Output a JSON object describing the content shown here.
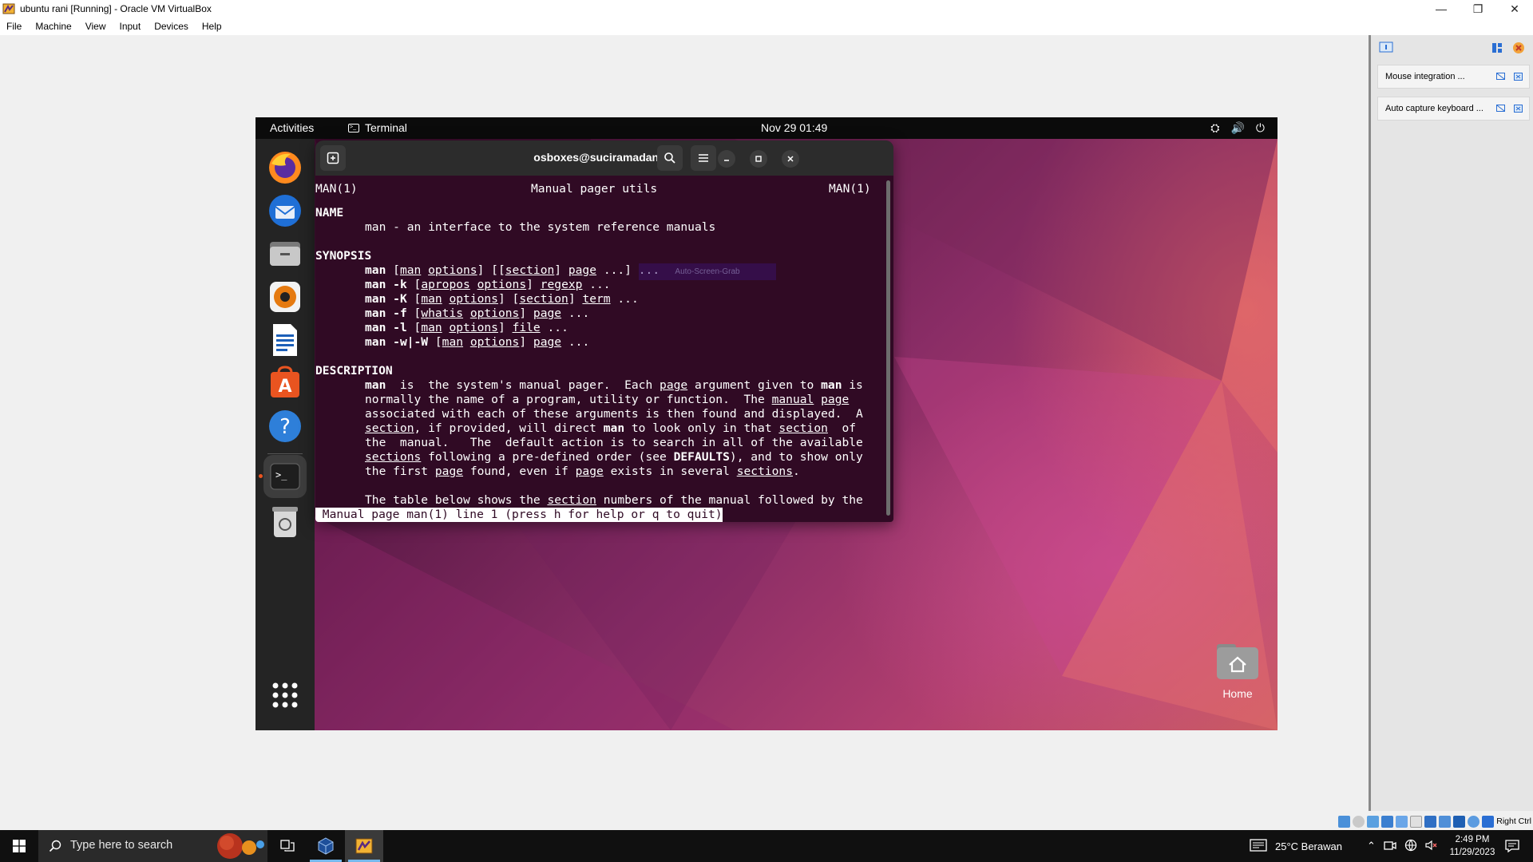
{
  "host_window": {
    "title": "ubuntu rani [Running] - Oracle VM VirtualBox",
    "controls": {
      "minimize": "—",
      "restore": "❐",
      "close": "✕"
    },
    "menu": [
      "File",
      "Machine",
      "View",
      "Input",
      "Devices",
      "Help"
    ]
  },
  "gnome": {
    "activities": "Activities",
    "app_name": "Terminal",
    "clock": "Nov 29  01:49"
  },
  "dock": {
    "apps": [
      "firefox-icon",
      "thunderbird-icon",
      "files-icon",
      "rhythmbox-icon",
      "libreoffice-writer-icon",
      "app-center-icon",
      "help-icon",
      "terminal-icon",
      "trash-icon",
      "show-apps-icon"
    ]
  },
  "terminal": {
    "title": "osboxes@suciramadani: ~",
    "lines": {
      "header_left": "MAN(1)",
      "header_center": "Manual pager utils",
      "header_right": "MAN(1)",
      "name_heading": "NAME",
      "name_desc": "man - an interface to the system reference manuals",
      "synopsis_heading": "SYNOPSIS",
      "description_heading": "DESCRIPTION",
      "status": " Manual page man(1) line 1 (press h for help or q to quit)"
    },
    "tokens": {
      "man": "man",
      "man_options": "man",
      "options": "options",
      "section": "section",
      "page": "page",
      "ellipsis": "...",
      "apropos": "apropos",
      "regexp": "regexp",
      "term": "term",
      "whatis": "whatis",
      "file": "file",
      "flag_k": "-k",
      "flag_K": "-K",
      "flag_f": "-f",
      "flag_l": "-l",
      "flag_w": "-w|-W",
      "manual": "manual",
      "sections": "sections",
      "defaults": "DEFAULTS"
    },
    "desc_text": {
      "l1a": "  is  the system's manual pager.  Each ",
      "l1b": " argument given to ",
      "l1c": " is",
      "l2a": "normally the name of a program, utility or function.  The ",
      "l2b": " ",
      "l3": "associated with each of these arguments is then found and displayed.  A",
      "l4a": ", if provided, will direct ",
      "l4b": " to look only in that ",
      "l4c": "  of",
      "l5": "the  manual.   The  default action is to search in all of the available",
      "l6a": " following a pre-defined order (see ",
      "l6b": "), and to show only",
      "l7a": "the first ",
      "l7b": " found, even if ",
      "l7c": " exists in several ",
      "l7d": ".",
      "l8a": "The table below shows the ",
      "l8b": " numbers of the manual followed by the"
    },
    "overlay_text": "Auto-Screen-Grab"
  },
  "desktop": {
    "home_label": "Home"
  },
  "vbox_panel": {
    "notices": [
      "Mouse integration ...",
      "Auto capture keyboard ..."
    ]
  },
  "vbox_status": {
    "host_key": "Right Ctrl"
  },
  "taskbar": {
    "search_placeholder": "Type here to search",
    "weather": "25°C  Berawan",
    "time": "2:49 PM",
    "date": "11/29/2023"
  },
  "colors": {
    "terminal_bg": "#300a24",
    "ubuntu_orange": "#e95420",
    "taskbar_bg": "#101010",
    "accent_blue": "#76b9ed"
  }
}
